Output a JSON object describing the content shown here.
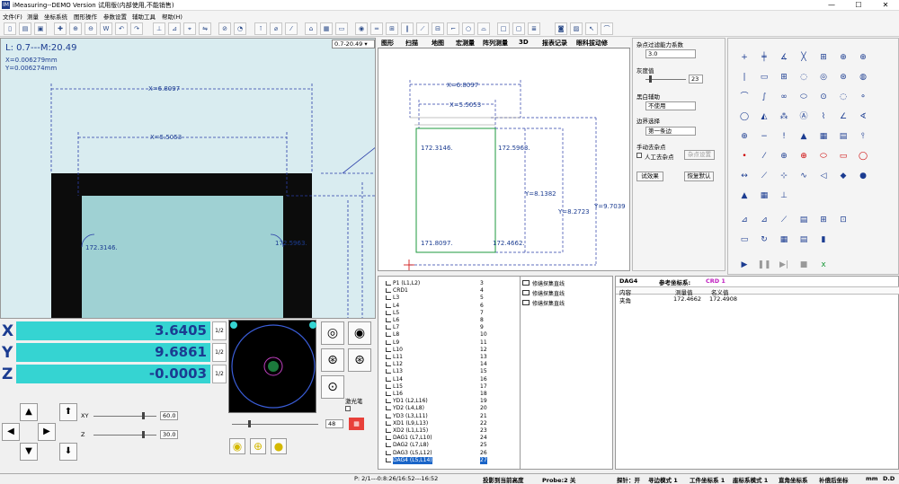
{
  "window": {
    "title": "iMeasuring--DEMO  Version  试用版(内部使用,不能销售)",
    "app_icon": "IM"
  },
  "menu": [
    "文件(F)",
    "测量",
    "坐标系统",
    "图形操作",
    "参数设置",
    "辅助工具",
    "帮助(H)"
  ],
  "image_view": {
    "length_readout": "L: 0.7---M:20.49",
    "x_readout": "X=0.006279mm",
    "y_readout": "Y=0.006274mm",
    "zoom_value": "0.7-20.49",
    "dim_outer": "X=6.8097",
    "dim_inner": "X=5.5053",
    "angle_left": "172.3146.",
    "angle_right": "172.5963."
  },
  "dro": {
    "x_label": "X",
    "x_value": "3.6405",
    "y_label": "Y",
    "y_value": "9.6861",
    "z_label": "Z",
    "z_value": "-0.0003",
    "half_label": "1/2"
  },
  "jog": {
    "xy_label": "XY",
    "xy_value": "60.0",
    "z_label": "Z",
    "z_value": "30.0"
  },
  "camera": {
    "laser_label": "激光笔",
    "light_value": "48"
  },
  "graphics_tabs": [
    "图形",
    "扫描",
    "地图",
    "宏测量",
    "阵列测量",
    "3D",
    "报表记录",
    "眼科拔动修"
  ],
  "graphics": {
    "dim_outer": "X=6.8097",
    "dim_inner": "X=5.5053",
    "y_a": "Y=8.1382",
    "y_b": "Y=8.2723",
    "y_c": "Y=9.7039",
    "ang_tl": "172.3146.",
    "ang_tr": "172.5963.",
    "ang_bl": "171.8097.",
    "ang_br": "172.4662."
  },
  "settings": {
    "filter_label": "杂点过滤能力系数",
    "filter_value": "3.0",
    "gray_label": "灰度值",
    "gray_value": "23",
    "bw_label": "黑白辅助",
    "bw_value": "不使用",
    "edge_label": "边界选择",
    "edge_value": "第一条边",
    "manual_label": "手动去杂点",
    "manual_check": "人工去杂点",
    "manual_btn": "杂点设置",
    "try_btn": "试效果",
    "reset_btn": "恢复默认"
  },
  "feature_list": [
    {
      "name": "P1 (L1,L2)",
      "num": "3"
    },
    {
      "name": "CRD1",
      "num": "4"
    },
    {
      "name": "L3",
      "num": "5"
    },
    {
      "name": "L4",
      "num": "6"
    },
    {
      "name": "L5",
      "num": "7"
    },
    {
      "name": "L6",
      "num": "8"
    },
    {
      "name": "L7",
      "num": "9"
    },
    {
      "name": "L8",
      "num": "10"
    },
    {
      "name": "L9",
      "num": "11"
    },
    {
      "name": "L10",
      "num": "12"
    },
    {
      "name": "L11",
      "num": "13"
    },
    {
      "name": "L12",
      "num": "14"
    },
    {
      "name": "L13",
      "num": "15"
    },
    {
      "name": "L14",
      "num": "16"
    },
    {
      "name": "L15",
      "num": "17"
    },
    {
      "name": "L16",
      "num": "18"
    },
    {
      "name": "YD1 (L2,L16)",
      "num": "19"
    },
    {
      "name": "YD2 (L4,L8)",
      "num": "20"
    },
    {
      "name": "YD3 (L3,L11)",
      "num": "21"
    },
    {
      "name": "XD1 (L9,L13)",
      "num": "22"
    },
    {
      "name": "XD2 (L1,L15)",
      "num": "23"
    },
    {
      "name": "DAG1 (L7,L10)",
      "num": "24"
    },
    {
      "name": "DAG2 (L7,L8)",
      "num": "25"
    },
    {
      "name": "DAG3 (L5,L12)",
      "num": "26"
    },
    {
      "name": "DAG4 (L5,L14)",
      "num": "27"
    }
  ],
  "construct_list": [
    "修缮探集直线",
    "修缮探集直线",
    "修缮探集直线"
  ],
  "result": {
    "feature": "DAG4",
    "ref_label": "参考坐标系:",
    "ref_value": "CRD 1",
    "col_content": "内容",
    "col_measured": "测量值",
    "col_nominal": "名义值",
    "row_name": "夹角",
    "row_measured": "172.4662",
    "row_nominal": "172.4908"
  },
  "status": {
    "pos": "P: 2/1---0:8:26/16:52---16:52",
    "project": "投影到当前高度",
    "probe": "Probe:2 关",
    "probe_state": "探针：开",
    "mode1": "寻边模式 1",
    "wcs": "工件坐标系 1",
    "coord_mode": "座标系模式 1",
    "rect": "直角坐标系",
    "comp": "补偿后坐标",
    "unit": "mm",
    "dd": "D.D"
  }
}
